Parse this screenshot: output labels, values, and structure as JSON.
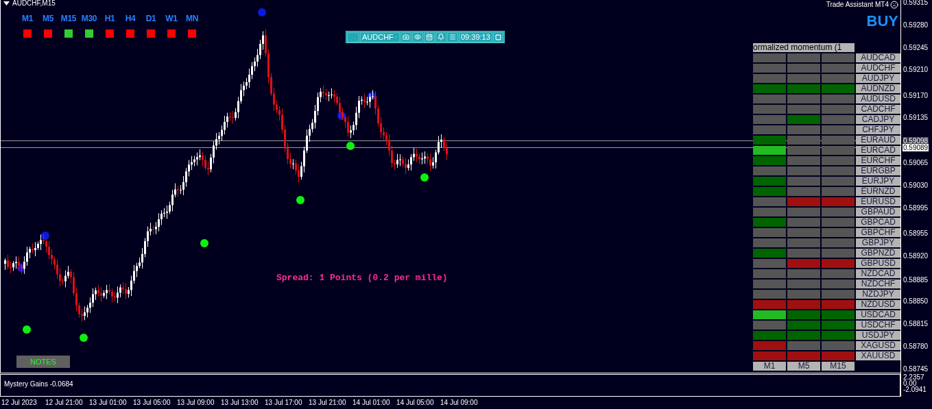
{
  "chart_title": "AUDCHF,M15",
  "timeframes": [
    {
      "label": "M1",
      "color": "#ff0000"
    },
    {
      "label": "M5",
      "color": "#ff0000"
    },
    {
      "label": "M15",
      "color": "#32cd32"
    },
    {
      "label": "M30",
      "color": "#32cd32"
    },
    {
      "label": "H1",
      "color": "#ff0000"
    },
    {
      "label": "H4",
      "color": "#ff0000"
    },
    {
      "label": "D1",
      "color": "#ff0000"
    },
    {
      "label": "W1",
      "color": "#ff0000"
    },
    {
      "label": "MN",
      "color": "#ff0000"
    }
  ],
  "toolbar": {
    "symbol": "AUDCHF",
    "time": "09:39:13"
  },
  "trade_assistant": "Trade Assistant MT4",
  "signal": "BUY",
  "spread": "Spread: 1 Points (0.2 per mille)",
  "notes_button": "NOTES",
  "momentum": {
    "header": "ormalized momentum (1",
    "rows": [
      {
        "symbol": "AUDCAD",
        "cells": [
          {
            "color": "#555555"
          },
          {
            "color": "#555555"
          },
          {
            "color": "#555555"
          }
        ]
      },
      {
        "symbol": "AUDCHF",
        "cells": [
          {
            "color": "#555555"
          },
          {
            "color": "#555555"
          },
          {
            "color": "#555555"
          }
        ]
      },
      {
        "symbol": "AUDJPY",
        "cells": [
          {
            "color": "#555555"
          },
          {
            "color": "#555555"
          },
          {
            "color": "#555555"
          }
        ]
      },
      {
        "symbol": "AUDNZD",
        "cells": [
          {
            "color": "#006400"
          },
          {
            "color": "#006400"
          },
          {
            "color": "#006400"
          }
        ]
      },
      {
        "symbol": "AUDUSD",
        "cells": [
          {
            "color": "#555555"
          },
          {
            "color": "#555555"
          },
          {
            "color": "#555555"
          }
        ]
      },
      {
        "symbol": "CADCHF",
        "cells": [
          {
            "color": "#555555"
          },
          {
            "color": "#555555"
          },
          {
            "color": "#555555"
          }
        ]
      },
      {
        "symbol": "CADJPY",
        "cells": [
          {
            "color": "#555555"
          },
          {
            "color": "#006400"
          },
          {
            "color": "#555555"
          }
        ]
      },
      {
        "symbol": "CHFJPY",
        "cells": [
          {
            "color": "#555555"
          },
          {
            "color": "#555555"
          },
          {
            "color": "#555555"
          }
        ]
      },
      {
        "symbol": "EURAUD",
        "cells": [
          {
            "color": "#006400"
          },
          {
            "color": "#555555"
          },
          {
            "color": "#555555"
          }
        ]
      },
      {
        "symbol": "EURCAD",
        "cells": [
          {
            "color": "#22bb22"
          },
          {
            "color": "#555555"
          },
          {
            "color": "#555555"
          }
        ]
      },
      {
        "symbol": "EURCHF",
        "cells": [
          {
            "color": "#006400"
          },
          {
            "color": "#555555"
          },
          {
            "color": "#555555"
          }
        ]
      },
      {
        "symbol": "EURGBP",
        "cells": [
          {
            "color": "#555555"
          },
          {
            "color": "#555555"
          },
          {
            "color": "#555555"
          }
        ]
      },
      {
        "symbol": "EURJPY",
        "cells": [
          {
            "color": "#006400"
          },
          {
            "color": "#555555"
          },
          {
            "color": "#555555"
          }
        ]
      },
      {
        "symbol": "EURNZD",
        "cells": [
          {
            "color": "#006400"
          },
          {
            "color": "#555555"
          },
          {
            "color": "#555555"
          }
        ]
      },
      {
        "symbol": "EURUSD",
        "cells": [
          {
            "color": "#555555"
          },
          {
            "color": "#a01010"
          },
          {
            "color": "#a01010"
          }
        ]
      },
      {
        "symbol": "GBPAUD",
        "cells": [
          {
            "color": "#555555"
          },
          {
            "color": "#555555"
          },
          {
            "color": "#555555"
          }
        ]
      },
      {
        "symbol": "GBPCAD",
        "cells": [
          {
            "color": "#006400"
          },
          {
            "color": "#555555"
          },
          {
            "color": "#555555"
          }
        ]
      },
      {
        "symbol": "GBPCHF",
        "cells": [
          {
            "color": "#555555"
          },
          {
            "color": "#555555"
          },
          {
            "color": "#555555"
          }
        ]
      },
      {
        "symbol": "GBPJPY",
        "cells": [
          {
            "color": "#555555"
          },
          {
            "color": "#555555"
          },
          {
            "color": "#555555"
          }
        ]
      },
      {
        "symbol": "GBPNZD",
        "cells": [
          {
            "color": "#006400"
          },
          {
            "color": "#555555"
          },
          {
            "color": "#555555"
          }
        ]
      },
      {
        "symbol": "GBPUSD",
        "cells": [
          {
            "color": "#555555"
          },
          {
            "color": "#a01010"
          },
          {
            "color": "#a01010"
          }
        ]
      },
      {
        "symbol": "NZDCAD",
        "cells": [
          {
            "color": "#555555"
          },
          {
            "color": "#555555"
          },
          {
            "color": "#555555"
          }
        ]
      },
      {
        "symbol": "NZDCHF",
        "cells": [
          {
            "color": "#555555"
          },
          {
            "color": "#555555"
          },
          {
            "color": "#555555"
          }
        ]
      },
      {
        "symbol": "NZDJPY",
        "cells": [
          {
            "color": "#555555"
          },
          {
            "color": "#555555"
          },
          {
            "color": "#555555"
          }
        ]
      },
      {
        "symbol": "NZDUSD",
        "cells": [
          {
            "color": "#a01010"
          },
          {
            "color": "#a01010"
          },
          {
            "color": "#a01010"
          }
        ]
      },
      {
        "symbol": "USDCAD",
        "cells": [
          {
            "color": "#22bb22"
          },
          {
            "color": "#006400"
          },
          {
            "color": "#006400"
          }
        ]
      },
      {
        "symbol": "USDCHF",
        "cells": [
          {
            "color": "#555555"
          },
          {
            "color": "#006400"
          },
          {
            "color": "#006400"
          }
        ]
      },
      {
        "symbol": "USDJPY",
        "cells": [
          {
            "color": "#006400"
          },
          {
            "color": "#006400"
          },
          {
            "color": "#006400"
          }
        ]
      },
      {
        "symbol": "XAGUSD",
        "cells": [
          {
            "color": "#a01010"
          },
          {
            "color": "#555555"
          },
          {
            "color": "#555555"
          }
        ]
      },
      {
        "symbol": "XAUUSD",
        "cells": [
          {
            "color": "#a01010"
          },
          {
            "color": "#a01010"
          },
          {
            "color": "#a01010"
          }
        ]
      }
    ],
    "footer": [
      "M1",
      "M5",
      "M15"
    ]
  },
  "price_axis": [
    {
      "text": "0.59315",
      "kind": "tick"
    },
    {
      "text": "0.59280",
      "kind": "tick"
    },
    {
      "text": "0.59245",
      "kind": "tick"
    },
    {
      "text": "0.59210",
      "kind": "tick"
    },
    {
      "text": "0.59170",
      "kind": "tick"
    },
    {
      "text": "0.59135",
      "kind": "tick"
    },
    {
      "text": "0.59098",
      "kind": "ask"
    },
    {
      "text": "0.59089",
      "kind": "bid"
    },
    {
      "text": "0.59065",
      "kind": "tick"
    },
    {
      "text": "0.59030",
      "kind": "tick"
    },
    {
      "text": "0.58995",
      "kind": "tick"
    },
    {
      "text": "0.58955",
      "kind": "tick"
    },
    {
      "text": "0.58920",
      "kind": "tick"
    },
    {
      "text": "0.58885",
      "kind": "tick"
    },
    {
      "text": "0.58850",
      "kind": "tick"
    },
    {
      "text": "0.58815",
      "kind": "tick"
    },
    {
      "text": "0.58780",
      "kind": "tick"
    },
    {
      "text": "0.58745",
      "kind": "tick"
    }
  ],
  "indicator": {
    "title": "Mystery Gains -0.0684",
    "axis": [
      "2.2357",
      "0.00",
      "-2.0941"
    ]
  },
  "time_axis": [
    "12 Jul 2023",
    "12 Jul 21:00",
    "13 Jul 01:00",
    "13 Jul 05:00",
    "13 Jul 09:00",
    "13 Jul 13:00",
    "13 Jul 17:00",
    "13 Jul 21:00",
    "14 Jul 01:00",
    "14 Jul 05:00",
    "14 Jul 09:00"
  ]
}
